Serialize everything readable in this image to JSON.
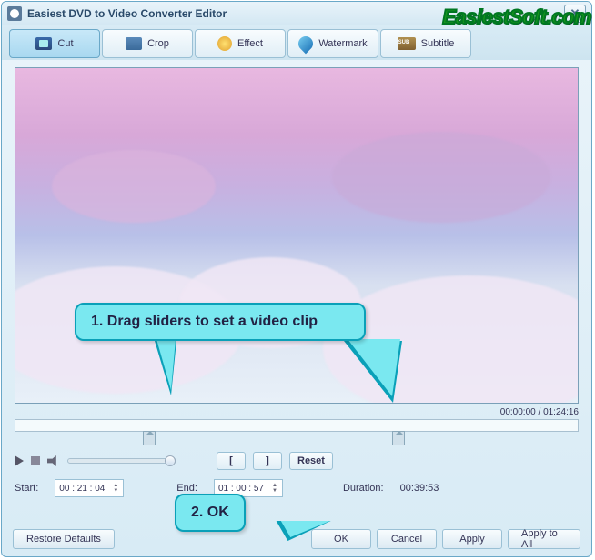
{
  "title": "Easiest DVD to Video Converter Editor",
  "watermark": "EasiestSoft.com",
  "tabs": {
    "cut": "Cut",
    "crop": "Crop",
    "effect": "Effect",
    "watermark": "Watermark",
    "subtitle": "Subtitle"
  },
  "time": {
    "current": "00:00:00",
    "total": "01:24:16"
  },
  "controls": {
    "reset": "Reset"
  },
  "range": {
    "start_label": "Start:",
    "start_value": "00 : 21 : 04",
    "end_label": "End:",
    "end_value": "01 : 00 : 57",
    "duration_label": "Duration:",
    "duration_value": "00:39:53"
  },
  "footer": {
    "restore": "Restore Defaults",
    "ok": "OK",
    "cancel": "Cancel",
    "apply": "Apply",
    "apply_all": "Apply to All"
  },
  "callouts": {
    "c1": "1. Drag sliders to set a video clip",
    "c2": "2. OK"
  }
}
